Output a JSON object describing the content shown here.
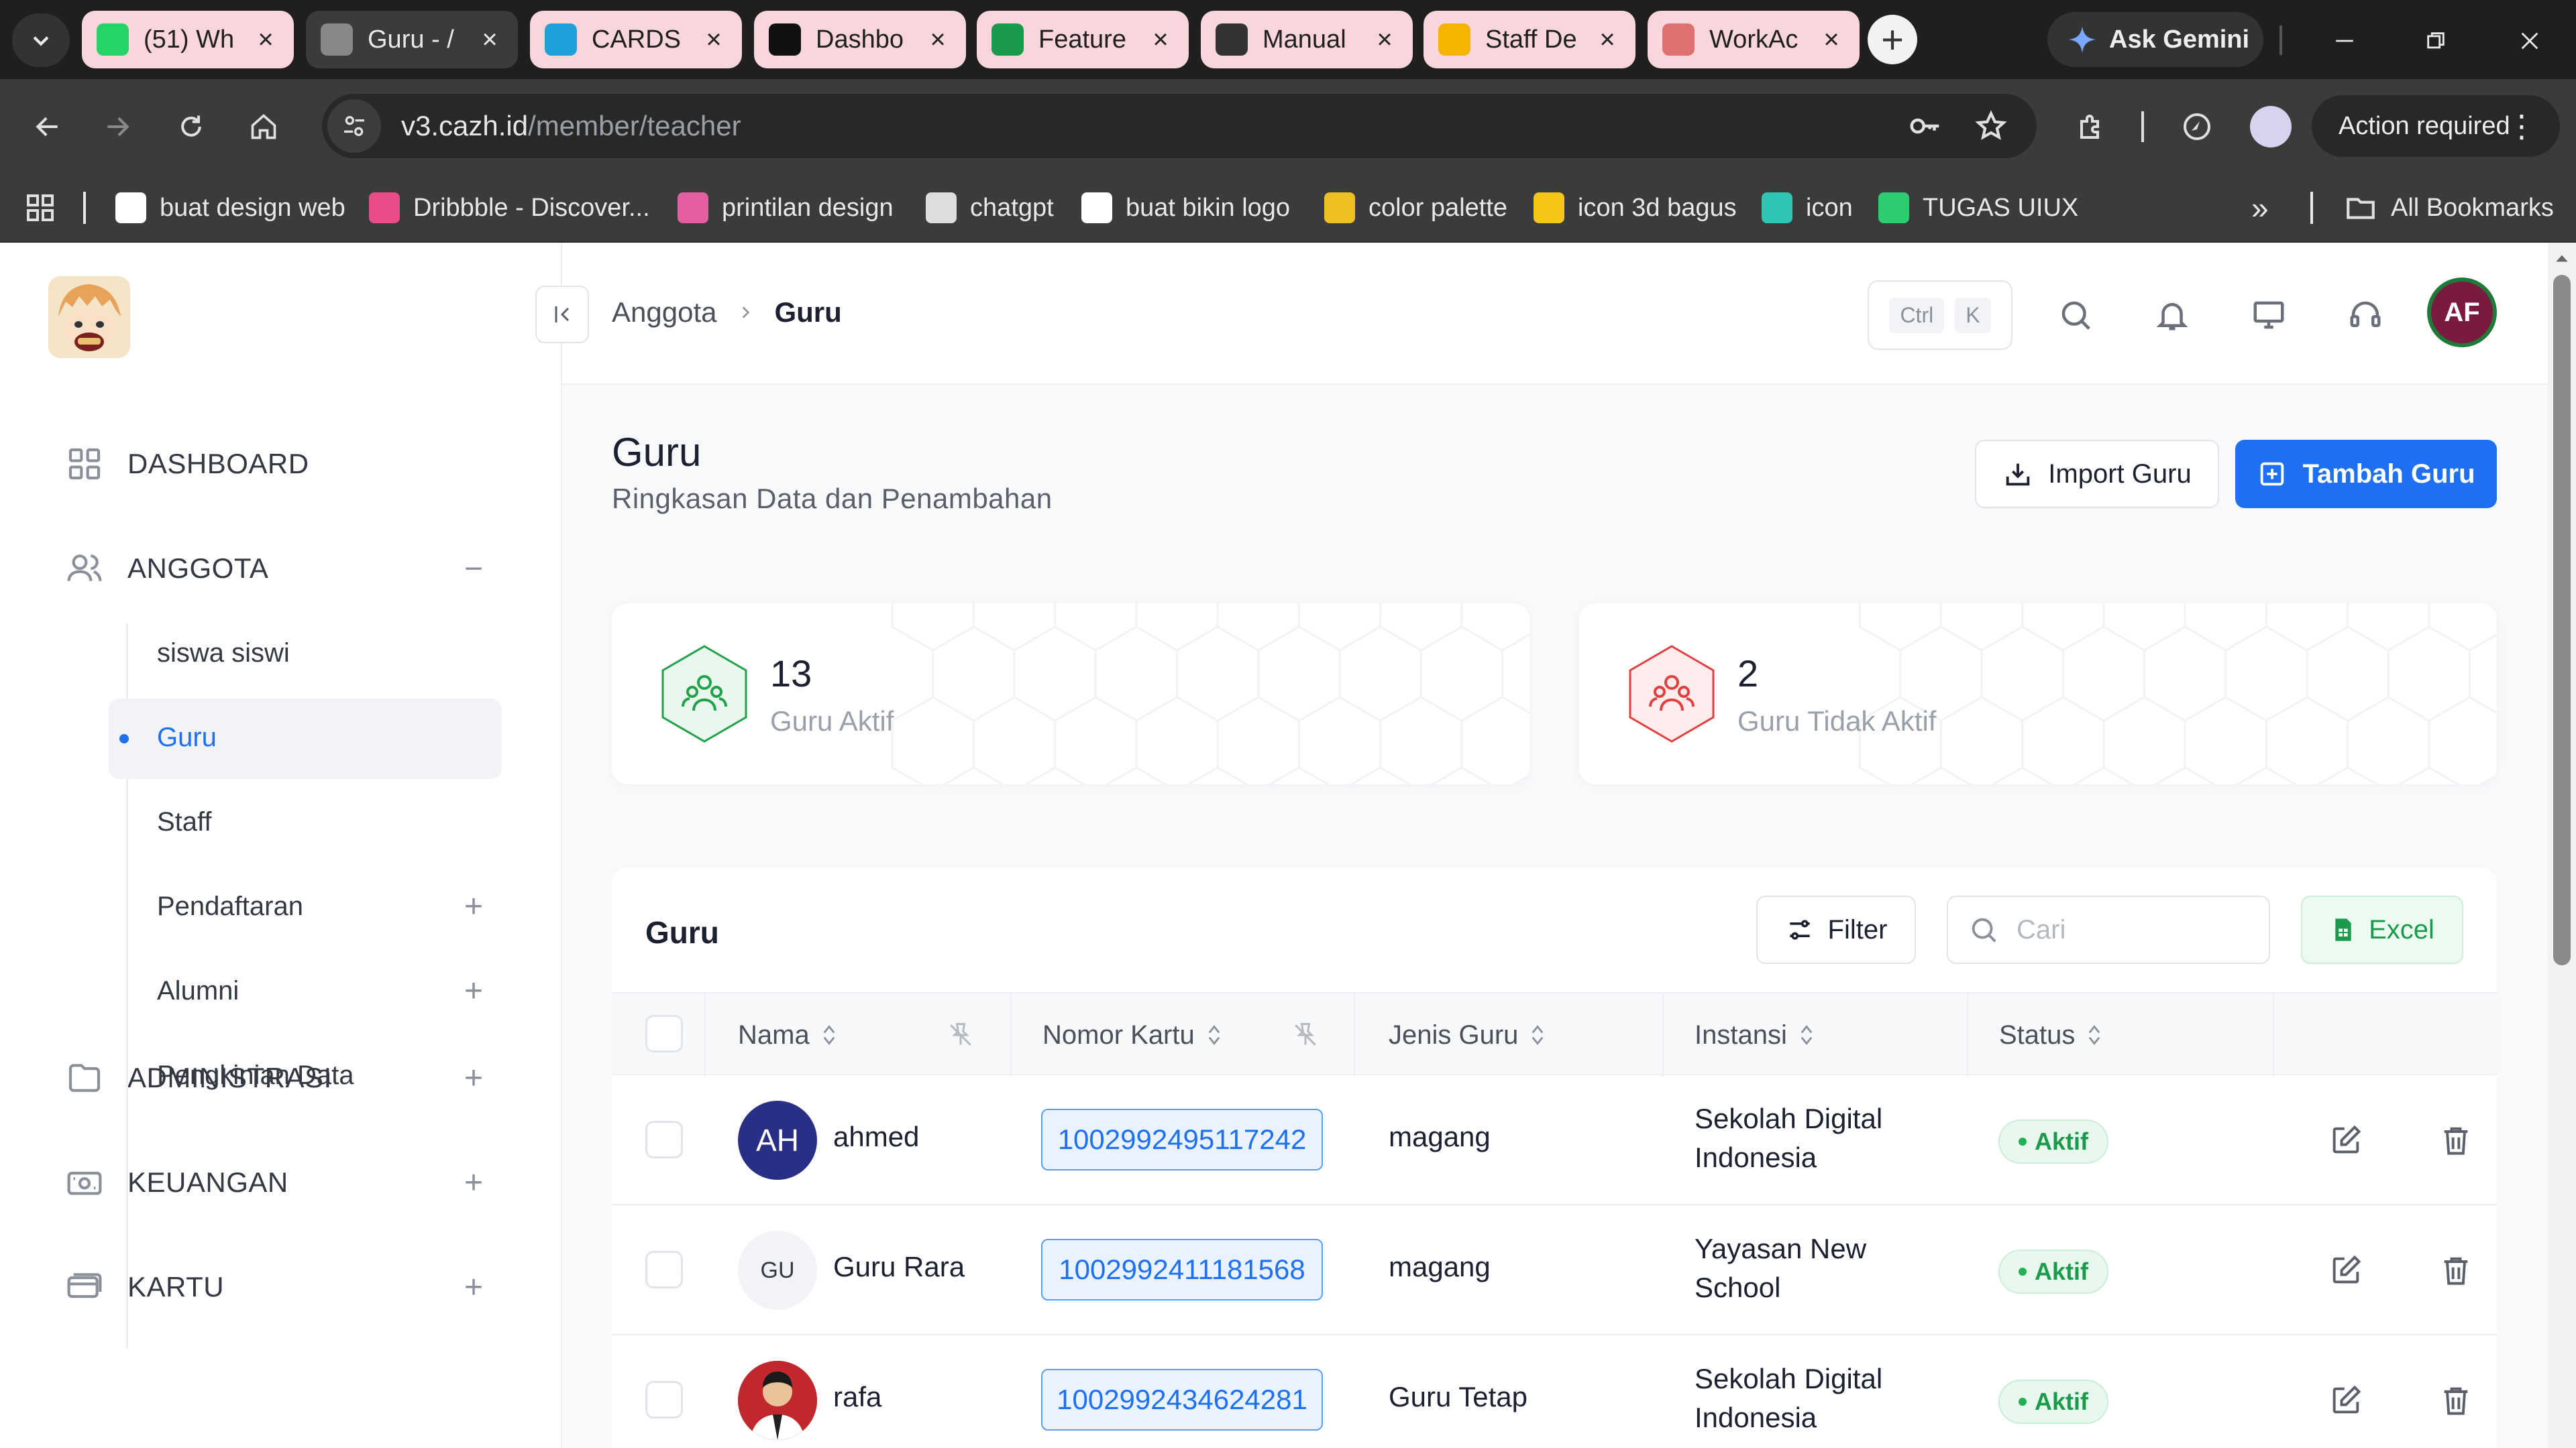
{
  "browser": {
    "tabs": [
      {
        "title": "(51) Wh",
        "icon": "whatsapp-icon",
        "color": "#25d366",
        "bg": "#f9d6dc",
        "active": false
      },
      {
        "title": "Guru - /",
        "icon": "globe-icon",
        "color": "#888888",
        "bg": "#3b3b3b",
        "active": true
      },
      {
        "title": "CARDS",
        "icon": "canva-icon",
        "color": "#1ea0d8",
        "bg": "#f9d6dc",
        "active": false
      },
      {
        "title": "Dashbo",
        "icon": "d-icon",
        "color": "#111111",
        "bg": "#f9d6dc",
        "active": false
      },
      {
        "title": "Feature",
        "icon": "sheets-icon",
        "color": "#1a9a4a",
        "bg": "#f9d6dc",
        "active": false
      },
      {
        "title": "Manual",
        "icon": "chatgpt-icon",
        "color": "#333333",
        "bg": "#f9d6dc",
        "active": false
      },
      {
        "title": "Staff De",
        "icon": "drive-icon",
        "color": "#f4b400",
        "bg": "#f9d6dc",
        "active": false
      },
      {
        "title": "WorkAc",
        "icon": "doc-icon",
        "color": "#e07070",
        "bg": "#f9d6dc",
        "active": false
      }
    ],
    "gemini_label": "Ask Gemini",
    "url_host": "v3.cazh.id",
    "url_path": "/member/teacher",
    "action_required": "Action required",
    "bookmarks": [
      {
        "label": "buat design web",
        "icon": "page-icon",
        "color": "#ffffff"
      },
      {
        "label": "Dribbble - Discover...",
        "icon": "dribbble-icon",
        "color": "#ea4c89"
      },
      {
        "label": "printilan design",
        "icon": "pinata-icon",
        "color": "#e35fa0"
      },
      {
        "label": "chatgpt",
        "icon": "chatgpt-icon",
        "color": "#dddddd"
      },
      {
        "label": "buat bikin logo",
        "icon": "wix-icon",
        "color": "#ffffff"
      },
      {
        "label": "color palette",
        "icon": "cup-icon",
        "color": "#f0c020"
      },
      {
        "label": "icon 3d bagus",
        "icon": "o-icon",
        "color": "#f5c518"
      },
      {
        "label": "icon",
        "icon": "vue-icon",
        "color": "#2ec4b6"
      },
      {
        "label": "TUGAS UIUX",
        "icon": "plus-green-icon",
        "color": "#2ecc71"
      }
    ],
    "all_bookmarks": "All Bookmarks"
  },
  "sidebar": {
    "items": [
      {
        "label": "DASHBOARD",
        "icon": "grid-icon",
        "toggle": ""
      },
      {
        "label": "ANGGOTA",
        "icon": "users-icon",
        "toggle": "−"
      },
      {
        "label": "ADMINISTRASI",
        "icon": "folder-icon",
        "toggle": "+"
      },
      {
        "label": "KEUANGAN",
        "icon": "wallet-icon",
        "toggle": "+"
      },
      {
        "label": "KARTU",
        "icon": "card-icon",
        "toggle": "+"
      }
    ],
    "sub_items": [
      {
        "label": "siswa siswi",
        "toggle": ""
      },
      {
        "label": "Guru",
        "toggle": "",
        "active": true
      },
      {
        "label": "Staff",
        "toggle": ""
      },
      {
        "label": "Pendaftaran",
        "toggle": "+"
      },
      {
        "label": "Alumni",
        "toggle": "+"
      },
      {
        "label": "Pengkinian Data",
        "toggle": ""
      }
    ]
  },
  "header": {
    "breadcrumb": [
      "Anggota",
      "Guru"
    ],
    "shortcut": [
      "Ctrl",
      "K"
    ],
    "avatar_initials": "AF"
  },
  "page": {
    "title": "Guru",
    "subtitle": "Ringkasan Data dan Penambahan",
    "import_label": "Import Guru",
    "add_label": "Tambah Guru"
  },
  "stats": [
    {
      "value": "13",
      "label": "Guru Aktif",
      "color": "#22a04a",
      "bg": "#e9f8ee"
    },
    {
      "value": "2",
      "label": "Guru Tidak Aktif",
      "color": "#e24040",
      "bg": "#fdecec"
    }
  ],
  "table": {
    "title": "Guru",
    "filter_label": "Filter",
    "search_placeholder": "Cari",
    "excel_label": "Excel",
    "columns": [
      "Nama",
      "Nomor Kartu",
      "Jenis Guru",
      "Instansi",
      "Status"
    ],
    "rows": [
      {
        "initials": "AH",
        "avatar_bg": "#2a2f86",
        "avatar_fg": "#ffffff",
        "name": "ahmed",
        "card": "1002992495117242",
        "type": "magang",
        "instansi": [
          "Sekolah Digital",
          "Indonesia"
        ],
        "status": "Aktif"
      },
      {
        "initials": "GU",
        "avatar_bg": "#f1f3f6",
        "avatar_fg": "#333842",
        "name": "Guru Rara",
        "card": "1002992411181568",
        "type": "magang",
        "instansi": [
          "Yayasan New",
          "School"
        ],
        "status": "Aktif"
      },
      {
        "initials": "",
        "avatar_bg": "#c0282d",
        "avatar_fg": "#ffffff",
        "name": "rafa",
        "card": "1002992434624281",
        "type": "Guru Tetap",
        "instansi": [
          "Sekolah Digital",
          "Indonesia"
        ],
        "status": "Aktif"
      }
    ]
  }
}
